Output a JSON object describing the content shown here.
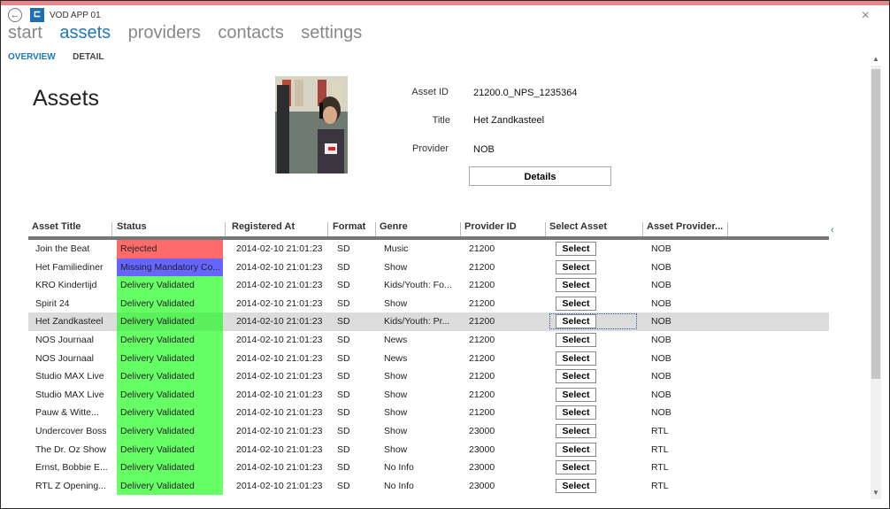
{
  "window": {
    "title": "VOD APP 01",
    "close_icon": "×",
    "back_icon": "←"
  },
  "nav": {
    "items": [
      "start",
      "assets",
      "providers",
      "contacts",
      "settings"
    ],
    "active": "assets"
  },
  "subnav": {
    "items": [
      "OVERVIEW",
      "DETAIL"
    ],
    "active": "OVERVIEW"
  },
  "page": {
    "heading": "Assets"
  },
  "details": {
    "asset_id_label": "Asset ID",
    "asset_id": "21200.0_NPS_1235364",
    "title_label": "Title",
    "title": "Het Zandkasteel",
    "provider_label": "Provider",
    "provider": "NOB",
    "details_button": "Details"
  },
  "grid": {
    "columns": [
      "Asset Title",
      "Status",
      "Registered At",
      "Format",
      "Genre",
      "Provider ID",
      "Select Asset",
      "Asset Provider..."
    ],
    "select_label": "Select",
    "rows": [
      {
        "title": "Join the Beat",
        "status": "Rejected",
        "status_color": "#ff6b6b",
        "registered": "2014-02-10 21:01:23",
        "format": "SD",
        "genre": "Music",
        "provider_id": "21200",
        "provider": "NOB"
      },
      {
        "title": "Het Familiediner",
        "status": "Missing Mandatory Co...",
        "status_color": "#6666ff",
        "registered": "2014-02-10 21:01:23",
        "format": "SD",
        "genre": "Show",
        "provider_id": "21200",
        "provider": "NOB"
      },
      {
        "title": "KRO Kindertijd",
        "status": "Delivery Validated",
        "status_color": "#66ff66",
        "registered": "2014-02-10 21:01:23",
        "format": "SD",
        "genre": "Kids/Youth: Fo...",
        "provider_id": "21200",
        "provider": "NOB"
      },
      {
        "title": "Spirit 24",
        "status": "Delivery Validated",
        "status_color": "#66ff66",
        "registered": "2014-02-10 21:01:23",
        "format": "SD",
        "genre": "Show",
        "provider_id": "21200",
        "provider": "NOB"
      },
      {
        "title": "Het Zandkasteel",
        "status": "Delivery Validated",
        "status_color": "#5cef5c",
        "registered": "2014-02-10 21:01:23",
        "format": "SD",
        "genre": "Kids/Youth: Pr...",
        "provider_id": "21200",
        "provider": "NOB",
        "selected": true
      },
      {
        "title": "NOS Journaal",
        "status": "Delivery Validated",
        "status_color": "#66ff66",
        "registered": "2014-02-10 21:01:23",
        "format": "SD",
        "genre": "News",
        "provider_id": "21200",
        "provider": "NOB"
      },
      {
        "title": "NOS Journaal",
        "status": "Delivery Validated",
        "status_color": "#66ff66",
        "registered": "2014-02-10 21:01:23",
        "format": "SD",
        "genre": "News",
        "provider_id": "21200",
        "provider": "NOB"
      },
      {
        "title": "Studio MAX Live",
        "status": "Delivery Validated",
        "status_color": "#66ff66",
        "registered": "2014-02-10 21:01:23",
        "format": "SD",
        "genre": "Show",
        "provider_id": "21200",
        "provider": "NOB"
      },
      {
        "title": "Studio MAX Live",
        "status": "Delivery Validated",
        "status_color": "#66ff66",
        "registered": "2014-02-10 21:01:23",
        "format": "SD",
        "genre": "Show",
        "provider_id": "21200",
        "provider": "NOB"
      },
      {
        "title": "Pauw & Witte...",
        "status": "Delivery Validated",
        "status_color": "#66ff66",
        "registered": "2014-02-10 21:01:23",
        "format": "SD",
        "genre": "Show",
        "provider_id": "21200",
        "provider": "NOB"
      },
      {
        "title": "Undercover Boss",
        "status": "Delivery Validated",
        "status_color": "#66ff66",
        "registered": "2014-02-10 21:01:23",
        "format": "SD",
        "genre": "Show",
        "provider_id": "23000",
        "provider": "RTL"
      },
      {
        "title": "The Dr. Oz Show",
        "status": "Delivery Validated",
        "status_color": "#66ff66",
        "registered": "2014-02-10 21:01:23",
        "format": "SD",
        "genre": "Show",
        "provider_id": "23000",
        "provider": "RTL"
      },
      {
        "title": "Ernst, Bobbie E...",
        "status": "Delivery Validated",
        "status_color": "#66ff66",
        "registered": "2014-02-10 21:01:23",
        "format": "SD",
        "genre": "No Info",
        "provider_id": "23000",
        "provider": "RTL"
      },
      {
        "title": "RTL Z Opening...",
        "status": "Delivery Validated",
        "status_color": "#66ff66",
        "registered": "2014-02-10 21:01:23",
        "format": "SD",
        "genre": "No Info",
        "provider_id": "23000",
        "provider": "RTL"
      }
    ]
  }
}
